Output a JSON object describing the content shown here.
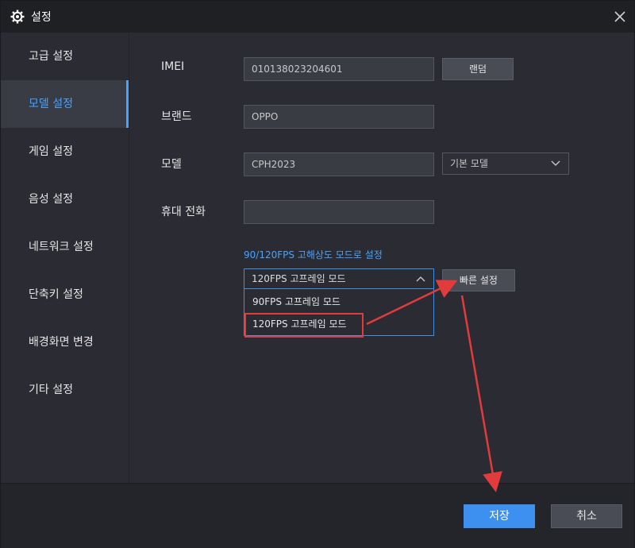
{
  "window": {
    "title": "설정"
  },
  "sidebar": {
    "items": [
      {
        "label": "고급 설정",
        "active": false
      },
      {
        "label": "모델 설정",
        "active": true
      },
      {
        "label": "게임 설정",
        "active": false
      },
      {
        "label": "음성 설정",
        "active": false
      },
      {
        "label": "네트워크 설정",
        "active": false
      },
      {
        "label": "단축키 설정",
        "active": false
      },
      {
        "label": "배경화면 변경",
        "active": false
      },
      {
        "label": "기타 설정",
        "active": false
      }
    ]
  },
  "form": {
    "imei": {
      "label": "IMEI",
      "value": "010138023204601",
      "random_button": "랜덤"
    },
    "brand": {
      "label": "브랜드",
      "value": "OPPO"
    },
    "model": {
      "label": "모델",
      "value": "CPH2023",
      "preset_select": "기본 모델"
    },
    "phone": {
      "label": "휴대 전화",
      "value": ""
    },
    "fps": {
      "hint": "90/120FPS 고해상도 모드로 설정",
      "selected": "120FPS 고프레임 모드",
      "options": [
        "90FPS 고프레임 모드",
        "120FPS 고프레임 모드"
      ],
      "quick_button": "빠른 설정"
    }
  },
  "footer": {
    "save_label": "저장",
    "cancel_label": "취소"
  },
  "colors": {
    "accent": "#46a3ff",
    "annotation": "#e23b3b"
  }
}
